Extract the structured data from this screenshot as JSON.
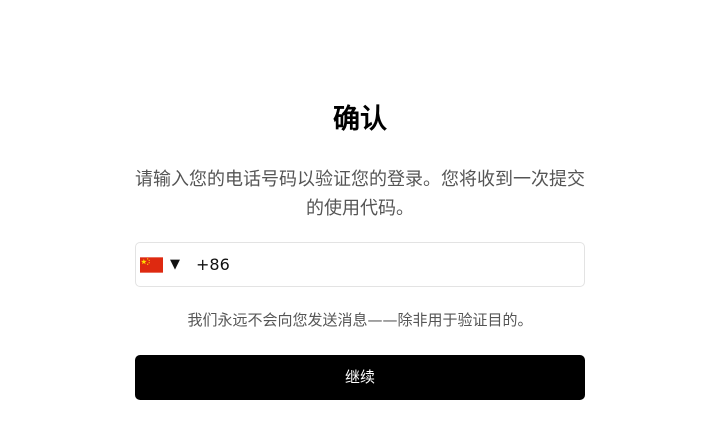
{
  "title": "确认",
  "subtitle": "请输入您的电话号码以验证您的登录。您将收到一次提交的使用代码。",
  "phone": {
    "country_flag": "china-flag-icon",
    "caret": "▼",
    "value": "+86"
  },
  "note": "我们永远不会向您发送消息——除非用于验证目的。",
  "continue_button": "继续",
  "colors": {
    "button_bg": "#000000",
    "button_text": "#ffffff",
    "muted_text": "#555555",
    "field_border": "#e3e3e3",
    "flag_red": "#de2910",
    "flag_yellow": "#ffde00"
  }
}
